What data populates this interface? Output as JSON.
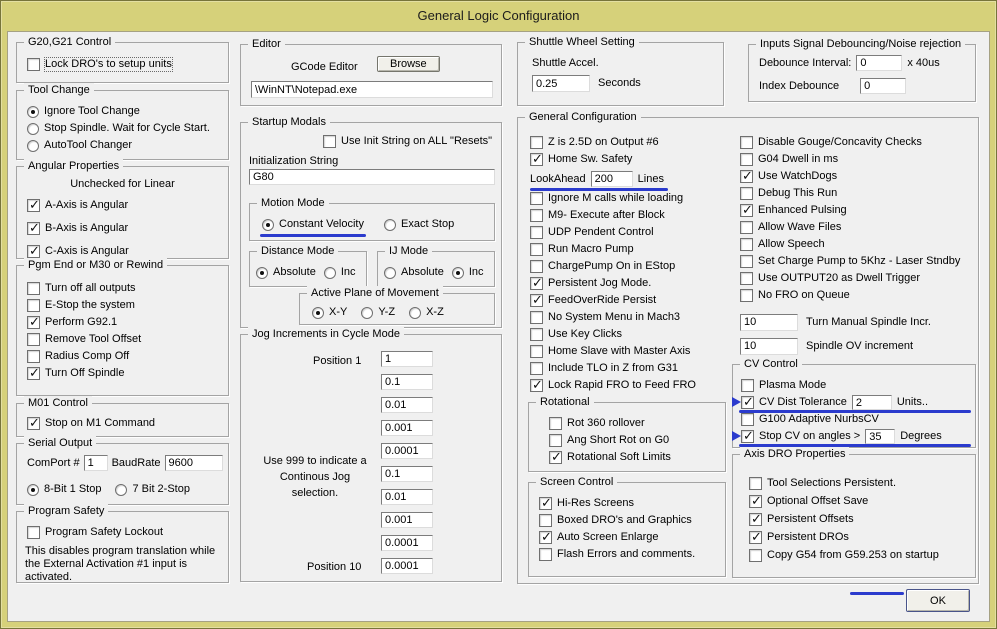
{
  "window": {
    "title": "General Logic Configuration"
  },
  "colors": {
    "annotation": "#2b3bcd",
    "frame": "#d6d17a"
  },
  "ok_label": "OK",
  "g20": {
    "legend": "G20,G21 Control",
    "items": [
      {
        "label": "Lock DRO's to setup units",
        "checked": false
      }
    ]
  },
  "tool_change": {
    "legend": "Tool Change",
    "options": [
      {
        "label": "Ignore Tool Change",
        "selected": true
      },
      {
        "label": "Stop Spindle. Wait for Cycle Start.",
        "selected": false
      },
      {
        "label": "AutoTool Changer",
        "selected": false
      }
    ]
  },
  "angular": {
    "legend": "Angular Properties",
    "note": "Unchecked for Linear",
    "items": [
      {
        "label": "A-Axis is Angular",
        "checked": true
      },
      {
        "label": "B-Axis is Angular",
        "checked": true
      },
      {
        "label": "C-Axis is Angular",
        "checked": true
      }
    ]
  },
  "pgm_end": {
    "legend": "Pgm End or M30 or Rewind",
    "items": [
      {
        "label": "Turn off all outputs",
        "checked": false
      },
      {
        "label": "E-Stop the system",
        "checked": false
      },
      {
        "label": "Perform G92.1",
        "checked": true
      },
      {
        "label": "Remove Tool Offset",
        "checked": false
      },
      {
        "label": "Radius Comp Off",
        "checked": false
      },
      {
        "label": "Turn Off Spindle",
        "checked": true
      }
    ]
  },
  "m01": {
    "legend": "M01 Control",
    "items": [
      {
        "label": "Stop on M1 Command",
        "checked": true
      }
    ]
  },
  "serial": {
    "legend": "Serial Output",
    "comport_label": "ComPort #",
    "comport_value": "1",
    "baud_label": "BaudRate",
    "baud_value": "9600",
    "options": [
      {
        "label": "8-Bit 1 Stop",
        "selected": true
      },
      {
        "label": "7 Bit 2-Stop",
        "selected": false
      }
    ]
  },
  "safety": {
    "legend": "Program Safety",
    "items": [
      {
        "label": "Program Safety Lockout",
        "checked": false
      }
    ],
    "note": "This disables program translation while the External Activation #1 input is activated."
  },
  "editor": {
    "legend": "Editor",
    "label": "GCode Editor",
    "browse_label": "Browse",
    "path": "\\WinNT\\Notepad.exe"
  },
  "startup": {
    "legend": "Startup Modals",
    "use_init": {
      "label": "Use Init String on ALL  \"Resets\"",
      "checked": false
    },
    "init_label": "Initialization String",
    "init_value": "G80",
    "motion": {
      "legend": "Motion Mode",
      "options": [
        {
          "label": "Constant Velocity",
          "selected": true
        },
        {
          "label": "Exact Stop",
          "selected": false
        }
      ]
    },
    "distance": {
      "legend": "Distance Mode",
      "options": [
        {
          "label": "Absolute",
          "selected": true
        },
        {
          "label": "Inc",
          "selected": false
        }
      ]
    },
    "ij": {
      "legend": "IJ Mode",
      "options": [
        {
          "label": "Absolute",
          "selected": false
        },
        {
          "label": "Inc",
          "selected": true
        }
      ]
    },
    "plane": {
      "legend": "Active Plane of Movement",
      "options": [
        {
          "label": "X-Y",
          "selected": true
        },
        {
          "label": "Y-Z",
          "selected": false
        },
        {
          "label": "X-Z",
          "selected": false
        }
      ]
    }
  },
  "jog": {
    "legend": "Jog Increments in Cycle Mode",
    "pos1_label": "Position 1",
    "pos10_label": "Position 10",
    "note": "Use 999 to indicate a Continous Jog selection.",
    "values": [
      "1",
      "0.1",
      "0.01",
      "0.001",
      "0.0001",
      "0.1",
      "0.01",
      "0.001",
      "0.0001",
      "0.0001"
    ]
  },
  "shuttle": {
    "legend": "Shuttle Wheel Setting",
    "label": "Shuttle Accel.",
    "value": "0.25",
    "unit": "Seconds"
  },
  "debounce": {
    "legend": "Inputs Signal Debouncing/Noise rejection",
    "interval_label": "Debounce Interval:",
    "interval_value": "0",
    "interval_unit": "x 40us",
    "index_label": "Index Debounce",
    "index_value": "0"
  },
  "general": {
    "legend": "General Configuration",
    "left_top": [
      {
        "label": "Z is 2.5D on Output #6",
        "checked": false
      },
      {
        "label": "Home Sw. Safety",
        "checked": true
      }
    ],
    "lookahead": {
      "label": "LookAhead",
      "value": "200",
      "unit": "Lines"
    },
    "left_items": [
      {
        "label": "Ignore M calls while loading",
        "checked": false
      },
      {
        "label": "M9- Execute after Block",
        "checked": false
      },
      {
        "label": "UDP Pendent Control",
        "checked": false
      },
      {
        "label": "Run Macro Pump",
        "checked": false
      },
      {
        "label": "ChargePump On in EStop",
        "checked": false
      },
      {
        "label": "Persistent Jog Mode.",
        "checked": true
      },
      {
        "label": "FeedOverRide Persist",
        "checked": true
      },
      {
        "label": "No System Menu in Mach3",
        "checked": false
      },
      {
        "label": "Use Key Clicks",
        "checked": false
      },
      {
        "label": "Home Slave with Master Axis",
        "checked": false
      },
      {
        "label": "Include TLO in Z from G31",
        "checked": false
      },
      {
        "label": "Lock Rapid FRO to Feed FRO",
        "checked": true
      }
    ],
    "rotational": {
      "legend": "Rotational",
      "items": [
        {
          "label": "Rot 360 rollover",
          "checked": false
        },
        {
          "label": "Ang Short Rot on G0",
          "checked": false
        },
        {
          "label": "Rotational Soft Limits",
          "checked": true
        }
      ]
    },
    "screen": {
      "legend": "Screen Control",
      "items": [
        {
          "label": "Hi-Res Screens",
          "checked": true
        },
        {
          "label": "Boxed DRO's and Graphics",
          "checked": false
        },
        {
          "label": "Auto Screen Enlarge",
          "checked": true
        },
        {
          "label": "Flash Errors and comments.",
          "checked": false
        }
      ]
    },
    "right_items": [
      {
        "label": "Disable Gouge/Concavity Checks",
        "checked": false
      },
      {
        "label": "G04 Dwell in ms",
        "checked": false
      },
      {
        "label": "Use WatchDogs",
        "checked": true
      },
      {
        "label": "Debug This Run",
        "checked": false
      },
      {
        "label": "Enhanced Pulsing",
        "checked": true
      },
      {
        "label": "Allow Wave Files",
        "checked": false
      },
      {
        "label": "Allow Speech",
        "checked": false
      },
      {
        "label": "Set Charge Pump to 5Khz - Laser Stndby",
        "checked": false
      },
      {
        "label": "Use OUTPUT20 as Dwell Trigger",
        "checked": false
      },
      {
        "label": "No FRO on Queue",
        "checked": false
      }
    ],
    "manual_spindle": {
      "value": "10",
      "label": "Turn Manual Spindle Incr."
    },
    "spindle_ov": {
      "value": "10",
      "label": "Spindle OV increment"
    }
  },
  "cv": {
    "legend": "CV Control",
    "plasma": {
      "label": "Plasma Mode",
      "checked": false
    },
    "dist": {
      "label": "CV Dist Tolerance",
      "checked": true,
      "value": "2",
      "unit": "Units.."
    },
    "nurbs": {
      "label": "G100 Adaptive NurbsCV",
      "checked": false
    },
    "angle": {
      "label": "Stop CV on angles >",
      "checked": true,
      "value": "35",
      "unit": "Degrees"
    }
  },
  "axis_dro": {
    "legend": "Axis DRO Properties",
    "items": [
      {
        "label": "Tool Selections Persistent.",
        "checked": false
      },
      {
        "label": "Optional Offset Save",
        "checked": true
      },
      {
        "label": "Persistent Offsets",
        "checked": true
      },
      {
        "label": "Persistent DROs",
        "checked": true
      },
      {
        "label": "Copy G54 from G59.253 on startup",
        "checked": false
      }
    ]
  }
}
